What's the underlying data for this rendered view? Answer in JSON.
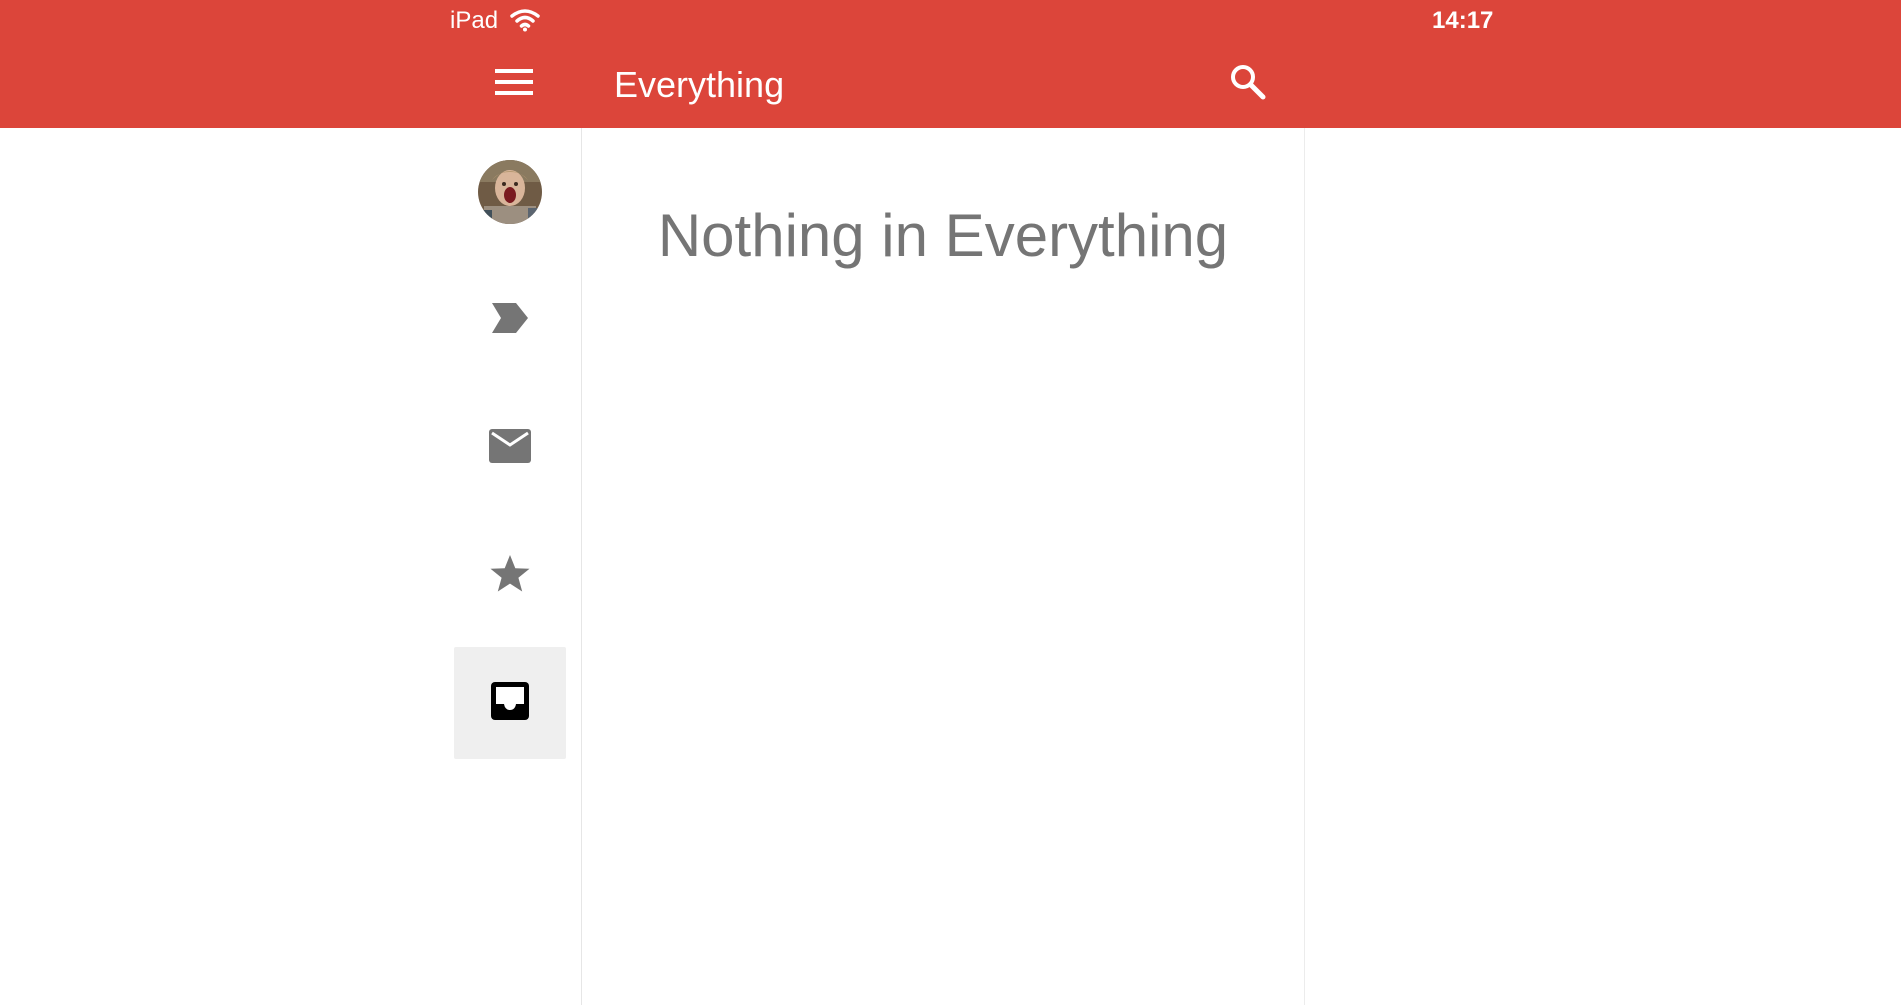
{
  "status_bar": {
    "device": "iPad",
    "time": "14:17",
    "wifi_icon": "wifi-icon"
  },
  "header": {
    "menu_icon": "hamburger-menu-icon",
    "title": "Everything",
    "search_icon": "search-icon",
    "background_color": "#dc453a"
  },
  "nav_rail": {
    "avatar": "user-avatar",
    "items": [
      {
        "icon": "label-arrow-icon",
        "active": false
      },
      {
        "icon": "mail-icon",
        "active": false
      },
      {
        "icon": "star-icon",
        "active": false
      },
      {
        "icon": "inbox-tray-icon",
        "active": true
      }
    ],
    "icon_color": "#757575",
    "active_background": "#efefef"
  },
  "list": {
    "empty_message": "Nothing in Everything"
  }
}
